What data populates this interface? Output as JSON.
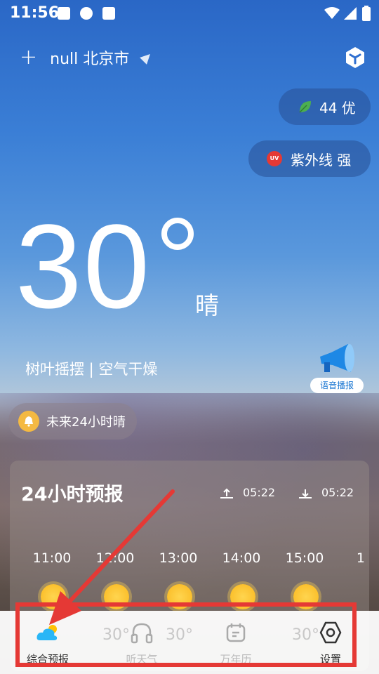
{
  "status_bar": {
    "time": "11:56"
  },
  "header": {
    "location": "null 北京市"
  },
  "air_quality": {
    "label": "44 优",
    "accent": "#4caf50"
  },
  "uv": {
    "badge": "UV",
    "label": "紫外线 强",
    "badge_color": "#e53935"
  },
  "current": {
    "temperature": "30",
    "condition": "晴",
    "description": "树叶摇摆 | 空气干燥"
  },
  "voice": {
    "label": "语音播报"
  },
  "notice": {
    "text": "未来24小时晴"
  },
  "forecast": {
    "title": "24小时预报",
    "sunrise": "05:22",
    "sunset": "05:22",
    "hours": [
      "11:00",
      "12:00",
      "13:00",
      "14:00",
      "15:00",
      "1"
    ],
    "temps": [
      "30°",
      "30°",
      "30°"
    ]
  },
  "tabs": [
    {
      "label": "综合预报",
      "icon": "cloud-sun-icon",
      "active": true
    },
    {
      "label": "听天气",
      "icon": "headphones-icon",
      "active": false
    },
    {
      "label": "万年历",
      "icon": "calendar-icon",
      "active": false
    },
    {
      "label": "设置",
      "icon": "settings-icon",
      "active": false
    }
  ],
  "annotation": {
    "color": "#e53935"
  }
}
